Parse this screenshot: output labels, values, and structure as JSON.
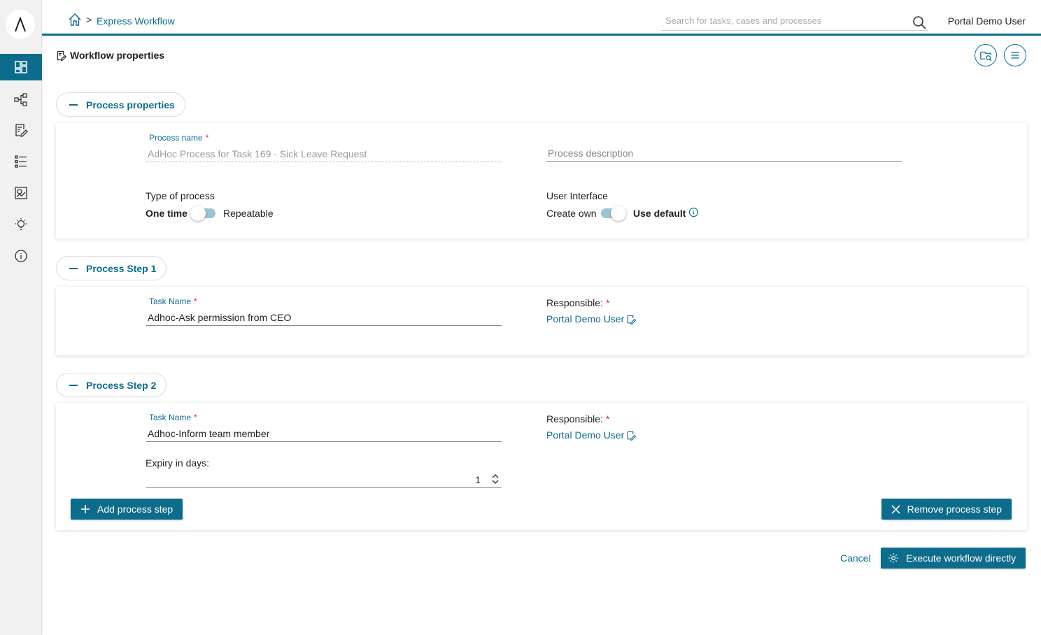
{
  "breadcrumb": {
    "current": "Express Workflow",
    "separator": ">"
  },
  "header": {
    "search_placeholder": "Search for tasks, cases and processes",
    "user": "Portal Demo User"
  },
  "page": {
    "title": "Workflow properties"
  },
  "process_properties": {
    "header": "Process properties",
    "name_label": "Process name",
    "name_value": "AdHoc Process for Task 169 - Sick Leave Request",
    "description_placeholder": "Process description",
    "type_label": "Type of process",
    "type_option_left": "One time",
    "type_option_right": "Repeatable",
    "ui_label": "User Interface",
    "ui_option_left": "Create own",
    "ui_option_right": "Use default"
  },
  "step1": {
    "header": "Process Step 1",
    "task_label": "Task Name",
    "task_value": "Adhoc-Ask permission from CEO",
    "responsible_label": "Responsible:",
    "responsible_user": "Portal Demo User"
  },
  "step2": {
    "header": "Process Step 2",
    "task_label": "Task Name",
    "task_value": "Adhoc-Inform team member",
    "responsible_label": "Responsible:",
    "responsible_user": "Portal Demo User",
    "expiry_label": "Expiry in days:",
    "expiry_value": "1"
  },
  "actions": {
    "add_step": "Add process step",
    "remove_step": "Remove process step",
    "cancel": "Cancel",
    "execute": "Execute workflow directly"
  },
  "colors": {
    "primary": "#0d6c8c",
    "required": "#d0243a"
  }
}
